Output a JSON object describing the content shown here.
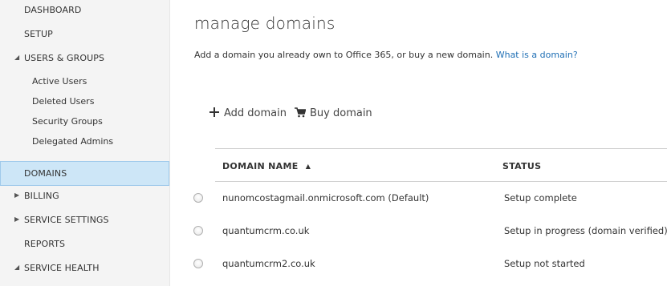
{
  "sidebar": {
    "dashboard": "DASHBOARD",
    "setup": "SETUP",
    "users_groups": "USERS & GROUPS",
    "sub_items": [
      "Active Users",
      "Deleted Users",
      "Security Groups",
      "Delegated Admins"
    ],
    "domains": "DOMAINS",
    "billing": "BILLING",
    "service_settings": "SERVICE SETTINGS",
    "reports": "REPORTS",
    "service_health": "SERVICE HEALTH"
  },
  "main": {
    "title": "manage domains",
    "description": "Add a domain you already own to Office 365, or buy a new domain.",
    "help_link": "What is a domain?",
    "toolbar": {
      "add_label": "Add domain",
      "buy_label": "Buy domain"
    },
    "table": {
      "headers": {
        "domain_name": "DOMAIN NAME",
        "status": "STATUS"
      },
      "rows": [
        {
          "domain": "nunomcostagmail.onmicrosoft.com (Default)",
          "status": "Setup complete"
        },
        {
          "domain": "quantumcrm.co.uk",
          "status": "Setup in progress (domain verified)"
        },
        {
          "domain": "quantumcrm2.co.uk",
          "status": "Setup not started"
        }
      ]
    }
  },
  "colors": {
    "selected_bg": "#cde6f7",
    "link": "#1f6fb5",
    "sidebar_bg": "#f4f4f4"
  }
}
